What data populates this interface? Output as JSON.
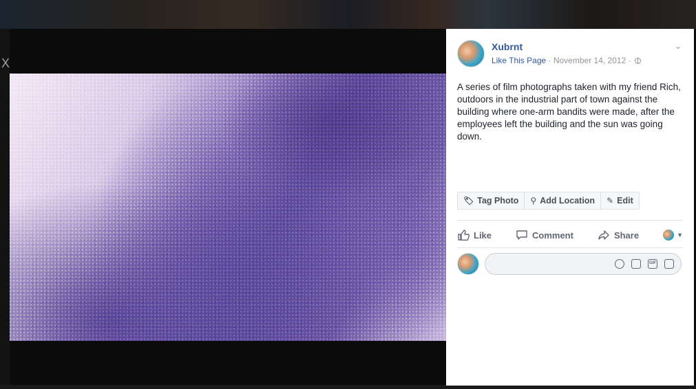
{
  "background": {
    "close_label": "X"
  },
  "post": {
    "page_name": "Xubrnt",
    "like_page": "Like This Page",
    "separator1": " · ",
    "date": "November 14, 2012",
    "separator2": " · ",
    "description": "A series of film photographs taken with my friend Rich, outdoors in the industrial part of town against the building where one-arm bandits were made, after the employees left the building and the sun was going down."
  },
  "photo_actions": {
    "tag_photo": "Tag Photo",
    "add_location": "Add Location",
    "edit": "Edit"
  },
  "reactions": {
    "like": "Like",
    "comment": "Comment",
    "share": "Share"
  },
  "comment": {
    "placeholder": "",
    "icons": [
      "emoji-icon",
      "camera-icon",
      "gif-icon",
      "sticker-icon"
    ]
  },
  "colors": {
    "link": "#365899",
    "muted": "#90949c",
    "text": "#1d2129"
  }
}
